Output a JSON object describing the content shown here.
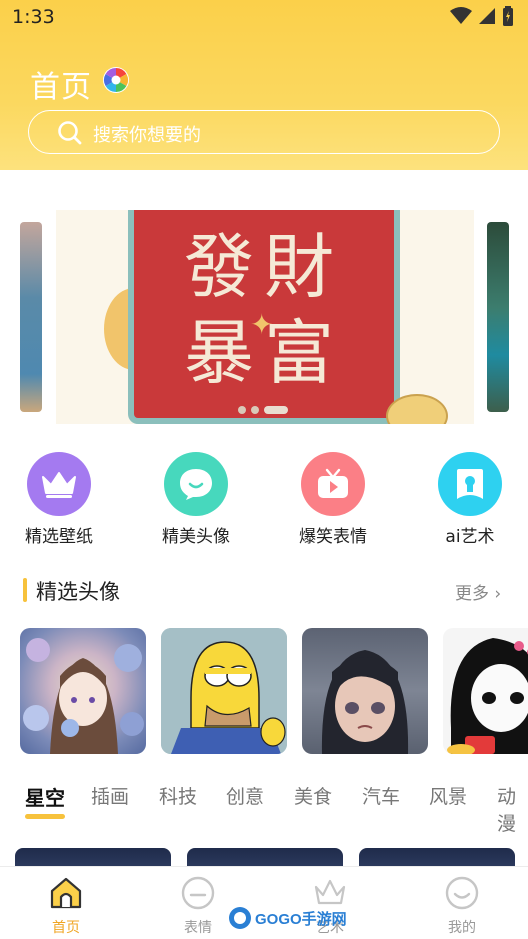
{
  "status_bar": {
    "time": "1:33",
    "icons": [
      "wifi-icon",
      "signal-icon",
      "battery-icon"
    ]
  },
  "header": {
    "title": "首页",
    "search_placeholder": "搜索你想要的",
    "background_color": "#fbd04a"
  },
  "banner": {
    "text_line1": "發財",
    "text_line2": "暴富",
    "slide_count": 3,
    "active_slide": 3
  },
  "categories": [
    {
      "label": "精选壁纸",
      "icon": "crown-icon",
      "color": "#a47af0"
    },
    {
      "label": "精美头像",
      "icon": "smile-bubble-icon",
      "color": "#47d8bd"
    },
    {
      "label": "爆笑表情",
      "icon": "tv-play-icon",
      "color": "#fb7f86"
    },
    {
      "label": "ai艺术",
      "icon": "ai-face-icon",
      "color": "#2ed1f0"
    }
  ],
  "featured_avatars": {
    "title": "精选头像",
    "more_label": "更多",
    "items": [
      "avatar-girl-flowers",
      "avatar-homer-thumbs-up",
      "avatar-crying-anime-girl",
      "avatar-manga-girl-redpacket"
    ]
  },
  "tabs": {
    "items": [
      "星空",
      "插画",
      "科技",
      "创意",
      "美食",
      "汽车",
      "风景",
      "动漫"
    ],
    "active_index": 0
  },
  "bottom_nav": {
    "items": [
      {
        "label": "首页",
        "icon": "home-icon",
        "active": true
      },
      {
        "label": "表情",
        "icon": "emoji-icon",
        "active": false
      },
      {
        "label": "艺术",
        "icon": "crown-outline-icon",
        "active": false
      },
      {
        "label": "我的",
        "icon": "profile-face-icon",
        "active": false
      }
    ],
    "active_color": "#f0a624"
  },
  "watermark": {
    "text": "GOGO手游网"
  }
}
